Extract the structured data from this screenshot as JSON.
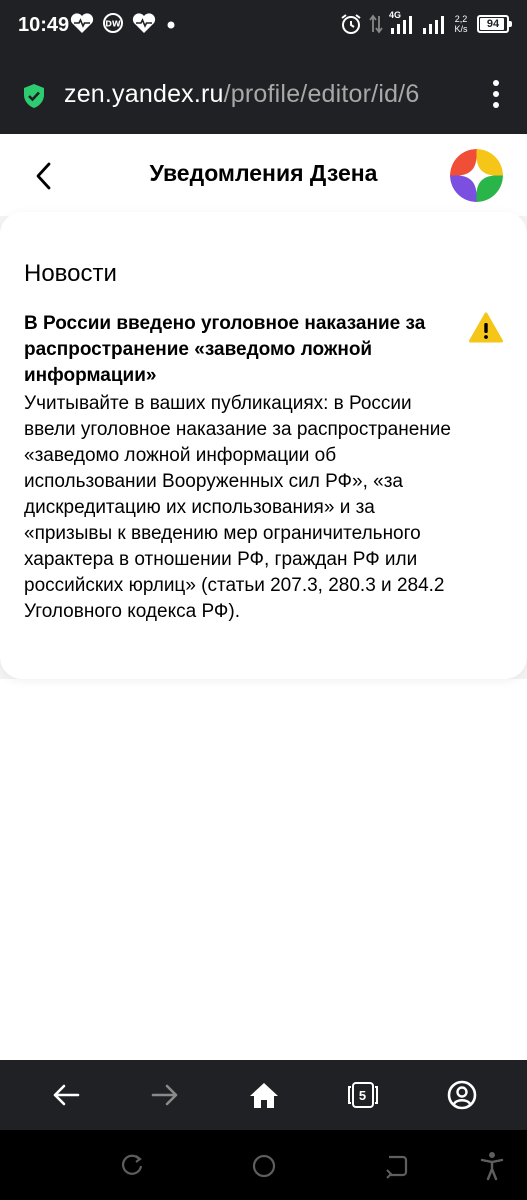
{
  "status_bar": {
    "time": "10:49",
    "network": "4G",
    "speed_value": "2,2",
    "speed_unit": "K/s",
    "battery_level": "94",
    "icons": [
      "heart-monitor-icon",
      "dw-icon",
      "heart-monitor-icon",
      "dot-icon",
      "alarm-icon",
      "data-arrows-icon",
      "signal-icon",
      "signal-icon",
      "battery-icon"
    ]
  },
  "browser": {
    "url_domain": "zen.yandex.ru",
    "url_path": "/profile/editor/id/6",
    "secure_icon": "shield-check-icon",
    "menu_icon": "more-vertical-icon"
  },
  "header": {
    "title": "Уведомления Дзена",
    "back_icon": "chevron-left-icon",
    "avatar_icon": "zen-logo-avatar"
  },
  "news": {
    "section_title": "Новости",
    "headline": "В России введено уголовное наказание за распространение «заведомо ложной информации»",
    "body": "Учитывайте в ваших публикациях: в России ввели уголовное наказание за распространение «заведомо ложной информации об использовании Вооруженных сил РФ», «за дискредитацию их использования» и за «призывы к введению мер ограничительного характера в отношении РФ, граждан РФ или российских юрлиц» (статьи 207.3, 280.3 и 284.2 Уголовного кодекса РФ).",
    "warning_icon": "warning-triangle-icon",
    "warning_color": "#f5c518"
  },
  "bottom_nav": {
    "back_icon": "arrow-left-icon",
    "forward_icon": "arrow-right-icon",
    "home_icon": "home-icon",
    "tabs_count": "5",
    "profile_icon": "account-circle-icon"
  },
  "system_nav": {
    "icons": [
      "recents-icon",
      "home-circle-icon",
      "back-icon",
      "accessibility-icon"
    ]
  },
  "colors": {
    "dark_bar": "#202124",
    "url_path": "#a8a8a8",
    "secure_green": "#2ecc71"
  }
}
